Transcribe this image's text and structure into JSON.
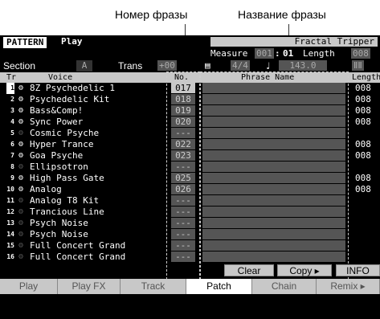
{
  "callouts": {
    "phrase_number": "Номер фразы",
    "phrase_name": "Название фразы"
  },
  "header": {
    "mode": "PATTERN",
    "mode_sub": "Play",
    "song_title": "Fractal Tripper"
  },
  "measure": {
    "label": "Measure",
    "value": "001",
    "beat": "01",
    "length_label": "Length",
    "length_value": "008"
  },
  "section": {
    "label": "Section",
    "value": "A",
    "trans_label": "Trans",
    "trans_value": "+00",
    "time_signature": "4/4",
    "tempo": "143.0",
    "meter_icon": "ⅡⅡ"
  },
  "columns": {
    "tr": "Tr",
    "voice": "Voice",
    "no": "No.",
    "phrase_name": "Phrase Name",
    "length": "Length"
  },
  "tracks": [
    {
      "num": "1",
      "voice": "8Z Psychedelic 1",
      "no": "017",
      "len": "008",
      "active": true
    },
    {
      "num": "2",
      "voice": "Psychedelic Kit",
      "no": "018",
      "len": "008",
      "active": true
    },
    {
      "num": "3",
      "voice": "Bass&Comp!",
      "no": "019",
      "len": "008",
      "active": true
    },
    {
      "num": "4",
      "voice": "Sync Power",
      "no": "020",
      "len": "008",
      "active": true
    },
    {
      "num": "5",
      "voice": "Cosmic Psyche",
      "no": "---",
      "len": "",
      "active": false
    },
    {
      "num": "6",
      "voice": "Hyper Trance",
      "no": "022",
      "len": "008",
      "active": true
    },
    {
      "num": "7",
      "voice": "Goa Psyche",
      "no": "023",
      "len": "008",
      "active": true
    },
    {
      "num": "8",
      "voice": "Ellipsotron",
      "no": "---",
      "len": "",
      "active": false
    },
    {
      "num": "9",
      "voice": "High Pass Gate",
      "no": "025",
      "len": "008",
      "active": true
    },
    {
      "num": "10",
      "voice": "Analog",
      "no": "026",
      "len": "008",
      "active": true
    },
    {
      "num": "11",
      "voice": "Analog T8 Kit",
      "no": "---",
      "len": "",
      "active": false
    },
    {
      "num": "12",
      "voice": "Trancious Line",
      "no": "---",
      "len": "",
      "active": false
    },
    {
      "num": "13",
      "voice": "Psych Noise",
      "no": "---",
      "len": "",
      "active": false
    },
    {
      "num": "14",
      "voice": "Psych Noise",
      "no": "---",
      "len": "",
      "active": false
    },
    {
      "num": "15",
      "voice": "Full Concert Grand",
      "no": "---",
      "len": "",
      "active": false
    },
    {
      "num": "16",
      "voice": "Full Concert Grand",
      "no": "---",
      "len": "",
      "active": false
    }
  ],
  "buttons": {
    "clear": "Clear",
    "copy": "Copy ▸",
    "info": "INFO"
  },
  "tabs": [
    "Play",
    "Play FX",
    "Track",
    "Patch",
    "Chain",
    "Remix ▸"
  ],
  "active_tab": "Patch",
  "icons": {
    "track_voice": "gear-icon",
    "tempo": "note-icon",
    "time_signature": "meter-icon"
  }
}
